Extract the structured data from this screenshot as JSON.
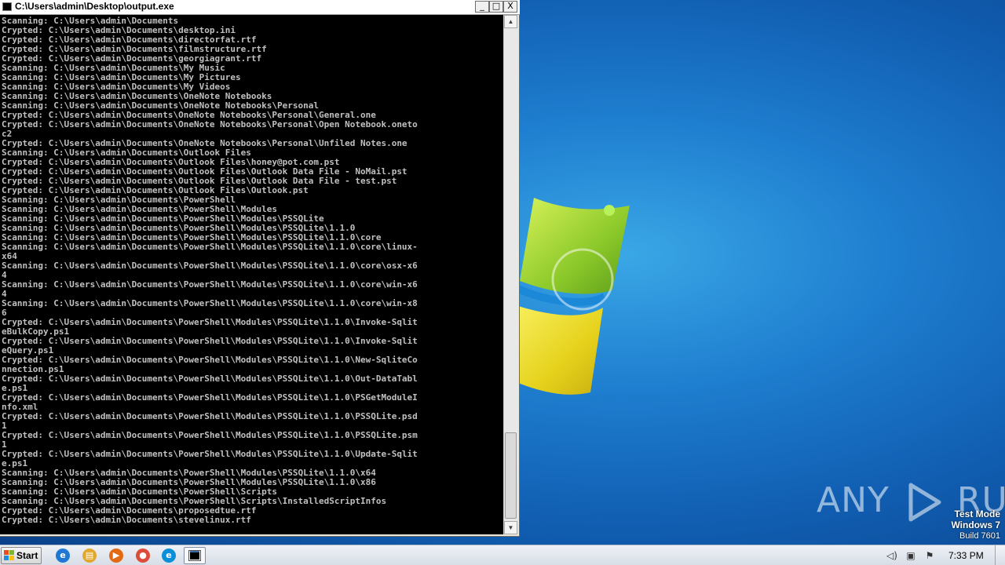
{
  "window": {
    "title": "C:\\Users\\admin\\Desktop\\output.exe",
    "minimize_glyph": "_",
    "maximize_glyph": "□",
    "close_glyph": "X"
  },
  "console": {
    "lines": [
      "Scanning: C:\\Users\\admin\\Documents",
      "Crypted: C:\\Users\\admin\\Documents\\desktop.ini",
      "Crypted: C:\\Users\\admin\\Documents\\directorfat.rtf",
      "Crypted: C:\\Users\\admin\\Documents\\filmstructure.rtf",
      "Crypted: C:\\Users\\admin\\Documents\\georgiagrant.rtf",
      "Scanning: C:\\Users\\admin\\Documents\\My Music",
      "Scanning: C:\\Users\\admin\\Documents\\My Pictures",
      "Scanning: C:\\Users\\admin\\Documents\\My Videos",
      "Scanning: C:\\Users\\admin\\Documents\\OneNote Notebooks",
      "Scanning: C:\\Users\\admin\\Documents\\OneNote Notebooks\\Personal",
      "Crypted: C:\\Users\\admin\\Documents\\OneNote Notebooks\\Personal\\General.one",
      "Crypted: C:\\Users\\admin\\Documents\\OneNote Notebooks\\Personal\\Open Notebook.oneto",
      "c2",
      "Crypted: C:\\Users\\admin\\Documents\\OneNote Notebooks\\Personal\\Unfiled Notes.one",
      "Scanning: C:\\Users\\admin\\Documents\\Outlook Files",
      "Crypted: C:\\Users\\admin\\Documents\\Outlook Files\\honey@pot.com.pst",
      "Crypted: C:\\Users\\admin\\Documents\\Outlook Files\\Outlook Data File - NoMail.pst",
      "Crypted: C:\\Users\\admin\\Documents\\Outlook Files\\Outlook Data File - test.pst",
      "Crypted: C:\\Users\\admin\\Documents\\Outlook Files\\Outlook.pst",
      "Scanning: C:\\Users\\admin\\Documents\\PowerShell",
      "Scanning: C:\\Users\\admin\\Documents\\PowerShell\\Modules",
      "Scanning: C:\\Users\\admin\\Documents\\PowerShell\\Modules\\PSSQLite",
      "Scanning: C:\\Users\\admin\\Documents\\PowerShell\\Modules\\PSSQLite\\1.1.0",
      "Scanning: C:\\Users\\admin\\Documents\\PowerShell\\Modules\\PSSQLite\\1.1.0\\core",
      "Scanning: C:\\Users\\admin\\Documents\\PowerShell\\Modules\\PSSQLite\\1.1.0\\core\\linux-",
      "x64",
      "Scanning: C:\\Users\\admin\\Documents\\PowerShell\\Modules\\PSSQLite\\1.1.0\\core\\osx-x6",
      "4",
      "Scanning: C:\\Users\\admin\\Documents\\PowerShell\\Modules\\PSSQLite\\1.1.0\\core\\win-x6",
      "4",
      "Scanning: C:\\Users\\admin\\Documents\\PowerShell\\Modules\\PSSQLite\\1.1.0\\core\\win-x8",
      "6",
      "Crypted: C:\\Users\\admin\\Documents\\PowerShell\\Modules\\PSSQLite\\1.1.0\\Invoke-Sqlit",
      "eBulkCopy.ps1",
      "Crypted: C:\\Users\\admin\\Documents\\PowerShell\\Modules\\PSSQLite\\1.1.0\\Invoke-Sqlit",
      "eQuery.ps1",
      "Crypted: C:\\Users\\admin\\Documents\\PowerShell\\Modules\\PSSQLite\\1.1.0\\New-SqliteCo",
      "nnection.ps1",
      "Crypted: C:\\Users\\admin\\Documents\\PowerShell\\Modules\\PSSQLite\\1.1.0\\Out-DataTabl",
      "e.ps1",
      "Crypted: C:\\Users\\admin\\Documents\\PowerShell\\Modules\\PSSQLite\\1.1.0\\PSGetModuleI",
      "nfo.xml",
      "Crypted: C:\\Users\\admin\\Documents\\PowerShell\\Modules\\PSSQLite\\1.1.0\\PSSQLite.psd",
      "1",
      "Crypted: C:\\Users\\admin\\Documents\\PowerShell\\Modules\\PSSQLite\\1.1.0\\PSSQLite.psm",
      "1",
      "Crypted: C:\\Users\\admin\\Documents\\PowerShell\\Modules\\PSSQLite\\1.1.0\\Update-Sqlit",
      "e.ps1",
      "Scanning: C:\\Users\\admin\\Documents\\PowerShell\\Modules\\PSSQLite\\1.1.0\\x64",
      "Scanning: C:\\Users\\admin\\Documents\\PowerShell\\Modules\\PSSQLite\\1.1.0\\x86",
      "Scanning: C:\\Users\\admin\\Documents\\PowerShell\\Scripts",
      "Scanning: C:\\Users\\admin\\Documents\\PowerShell\\Scripts\\InstalledScriptInfos",
      "Crypted: C:\\Users\\admin\\Documents\\proposedtue.rtf",
      "Crypted: C:\\Users\\admin\\Documents\\stevelinux.rtf"
    ]
  },
  "watermark": {
    "text_left": "ANY",
    "text_right": "RUN"
  },
  "os_info": {
    "line1": "Test Mode",
    "line2": "Windows 7",
    "line3": "Build 7601"
  },
  "taskbar": {
    "start_label": "Start",
    "pinned": [
      {
        "name": "ie-icon",
        "glyph": "e",
        "color": "#1e78d4"
      },
      {
        "name": "explorer-icon",
        "glyph": "▤",
        "color": "#e2a82e"
      },
      {
        "name": "media-player-icon",
        "glyph": "▶",
        "color": "#e36a12"
      },
      {
        "name": "chrome-icon",
        "glyph": "●",
        "color": "#dd4b39"
      },
      {
        "name": "edge-icon",
        "glyph": "e",
        "color": "#0c8ed9"
      }
    ],
    "clock": "7:33 PM"
  },
  "colors": {
    "console_bg": "#000000",
    "console_fg": "#c0c0c0",
    "desktop_blue": "#1f7fd0"
  }
}
